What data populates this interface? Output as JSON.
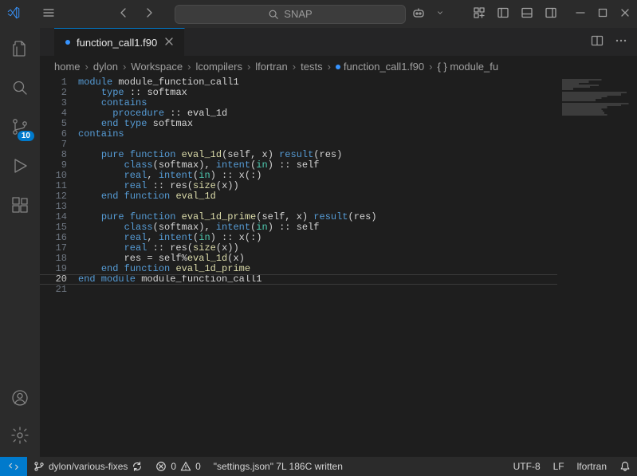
{
  "titlebar": {
    "search_placeholder": "SNAP"
  },
  "activity_bar": {
    "scm_badge": "10"
  },
  "tab": {
    "label": "function_call1.f90"
  },
  "breadcrumbs": {
    "items": [
      "home",
      "dylon",
      "Workspace",
      "lcompilers",
      "lfortran",
      "tests"
    ],
    "file": "function_call1.f90",
    "symbol": "module_fu"
  },
  "code": {
    "lines": [
      {
        "n": 1,
        "seg": [
          [
            "k",
            "module "
          ],
          [
            "n",
            "module_function_call1"
          ]
        ]
      },
      {
        "n": 2,
        "indent": 1,
        "seg": [
          [
            "k",
            "type "
          ],
          [
            "p",
            ":: "
          ],
          [
            "n",
            "softmax"
          ]
        ]
      },
      {
        "n": 3,
        "indent": 1,
        "seg": [
          [
            "k",
            "contains"
          ]
        ]
      },
      {
        "n": 4,
        "indent": 1,
        "guide": 1,
        "seg": [
          [
            "k",
            "procedure "
          ],
          [
            "p",
            ":: "
          ],
          [
            "n",
            "eval_1d"
          ]
        ]
      },
      {
        "n": 5,
        "indent": 1,
        "seg": [
          [
            "k",
            "end type "
          ],
          [
            "n",
            "softmax"
          ]
        ]
      },
      {
        "n": 6,
        "seg": [
          [
            "k",
            "contains"
          ]
        ]
      },
      {
        "n": 7,
        "seg": []
      },
      {
        "n": 8,
        "indent": 1,
        "seg": [
          [
            "k",
            "pure function "
          ],
          [
            "f",
            "eval_1d"
          ],
          [
            "p",
            "("
          ],
          [
            "n",
            "self"
          ],
          [
            "p",
            ", "
          ],
          [
            "n",
            "x"
          ],
          [
            "p",
            ") "
          ],
          [
            "k",
            "result"
          ],
          [
            "p",
            "("
          ],
          [
            "n",
            "res"
          ],
          [
            "p",
            ")"
          ]
        ]
      },
      {
        "n": 9,
        "indent": 1,
        "guide": 1,
        "seg": [
          [
            "k",
            "class"
          ],
          [
            "p",
            "("
          ],
          [
            "n",
            "softmax"
          ],
          [
            "p",
            "), "
          ],
          [
            "k",
            "intent"
          ],
          [
            "p",
            "("
          ],
          [
            "intent",
            "in"
          ],
          [
            "p",
            ") :: "
          ],
          [
            "n",
            "self"
          ]
        ]
      },
      {
        "n": 10,
        "indent": 1,
        "guide": 1,
        "seg": [
          [
            "k",
            "real"
          ],
          [
            "p",
            ", "
          ],
          [
            "k",
            "intent"
          ],
          [
            "p",
            "("
          ],
          [
            "intent",
            "in"
          ],
          [
            "p",
            ") :: "
          ],
          [
            "n",
            "x"
          ],
          [
            "p",
            "(:)"
          ]
        ]
      },
      {
        "n": 11,
        "indent": 1,
        "guide": 1,
        "seg": [
          [
            "k",
            "real"
          ],
          [
            "p",
            " :: "
          ],
          [
            "n",
            "res"
          ],
          [
            "p",
            "("
          ],
          [
            "f",
            "size"
          ],
          [
            "p",
            "("
          ],
          [
            "n",
            "x"
          ],
          [
            "p",
            "))"
          ]
        ]
      },
      {
        "n": 12,
        "indent": 1,
        "seg": [
          [
            "k",
            "end function "
          ],
          [
            "f",
            "eval_1d"
          ]
        ]
      },
      {
        "n": 13,
        "seg": []
      },
      {
        "n": 14,
        "indent": 1,
        "seg": [
          [
            "k",
            "pure function "
          ],
          [
            "f",
            "eval_1d_prime"
          ],
          [
            "p",
            "("
          ],
          [
            "n",
            "self"
          ],
          [
            "p",
            ", "
          ],
          [
            "n",
            "x"
          ],
          [
            "p",
            ") "
          ],
          [
            "k",
            "result"
          ],
          [
            "p",
            "("
          ],
          [
            "n",
            "res"
          ],
          [
            "p",
            ")"
          ]
        ]
      },
      {
        "n": 15,
        "indent": 1,
        "guide": 1,
        "seg": [
          [
            "k",
            "class"
          ],
          [
            "p",
            "("
          ],
          [
            "n",
            "softmax"
          ],
          [
            "p",
            "), "
          ],
          [
            "k",
            "intent"
          ],
          [
            "p",
            "("
          ],
          [
            "intent",
            "in"
          ],
          [
            "p",
            ") :: "
          ],
          [
            "n",
            "self"
          ]
        ]
      },
      {
        "n": 16,
        "indent": 1,
        "guide": 1,
        "seg": [
          [
            "k",
            "real"
          ],
          [
            "p",
            ", "
          ],
          [
            "k",
            "intent"
          ],
          [
            "p",
            "("
          ],
          [
            "intent",
            "in"
          ],
          [
            "p",
            ") :: "
          ],
          [
            "n",
            "x"
          ],
          [
            "p",
            "(:)"
          ]
        ]
      },
      {
        "n": 17,
        "indent": 1,
        "guide": 1,
        "seg": [
          [
            "k",
            "real"
          ],
          [
            "p",
            " :: "
          ],
          [
            "n",
            "res"
          ],
          [
            "p",
            "("
          ],
          [
            "f",
            "size"
          ],
          [
            "p",
            "("
          ],
          [
            "n",
            "x"
          ],
          [
            "p",
            "))"
          ]
        ]
      },
      {
        "n": 18,
        "indent": 1,
        "guide": 1,
        "seg": [
          [
            "n",
            "res "
          ],
          [
            "p",
            "= "
          ],
          [
            "n",
            "self"
          ],
          [
            "p",
            "%"
          ],
          [
            "f",
            "eval_1d"
          ],
          [
            "p",
            "("
          ],
          [
            "n",
            "x"
          ],
          [
            "p",
            ")"
          ]
        ]
      },
      {
        "n": 19,
        "indent": 1,
        "seg": [
          [
            "k",
            "end function "
          ],
          [
            "f",
            "eval_1d_prime"
          ]
        ]
      },
      {
        "n": 20,
        "highlight": true,
        "seg": [
          [
            "k",
            "end module "
          ],
          [
            "n",
            "module_function_call1"
          ]
        ]
      },
      {
        "n": 21,
        "seg": []
      }
    ]
  },
  "statusbar": {
    "branch": "dylon/various-fixes",
    "errors": "0",
    "warnings": "0",
    "message": "\"settings.json\" 7L 186C written",
    "encoding": "UTF-8",
    "eol": "LF",
    "language": "lfortran"
  }
}
